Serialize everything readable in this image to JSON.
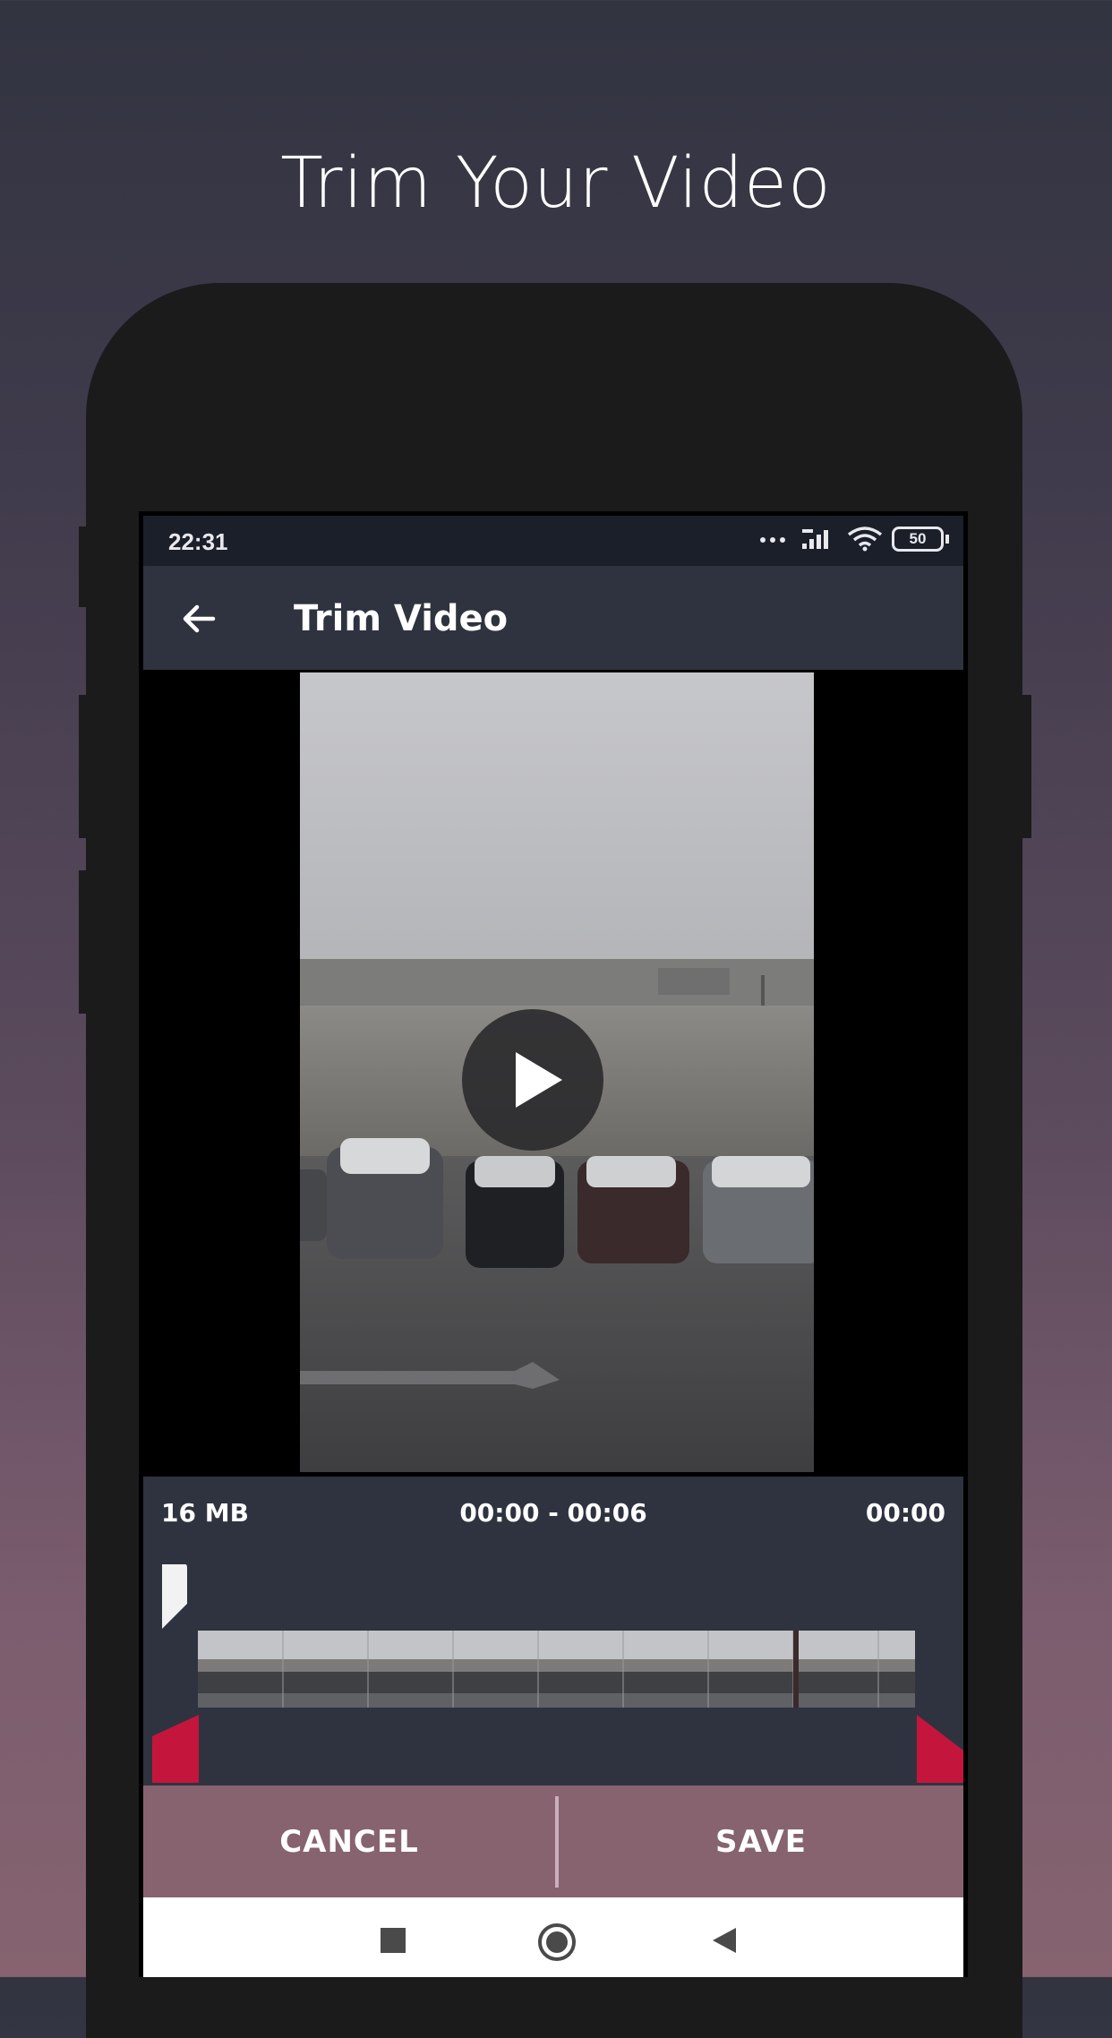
{
  "promo": {
    "headline": "Trim Your Video"
  },
  "status_bar": {
    "time": "22:31",
    "battery": "50"
  },
  "app_bar": {
    "title": "Trim Video"
  },
  "trim_info": {
    "file_size": "16 MB",
    "range": "00:00  - 00:06",
    "position": "00:00"
  },
  "actions": {
    "cancel_label": "CANCEL",
    "save_label": "SAVE"
  },
  "colors": {
    "accent": "#c4163c",
    "action_bar": "#86636f",
    "panel": "#2f3340"
  },
  "icons": {
    "back": "arrow-left-icon",
    "play": "play-icon",
    "nav_recents": "square-icon",
    "nav_home": "circle-icon",
    "nav_back": "triangle-left-icon"
  }
}
